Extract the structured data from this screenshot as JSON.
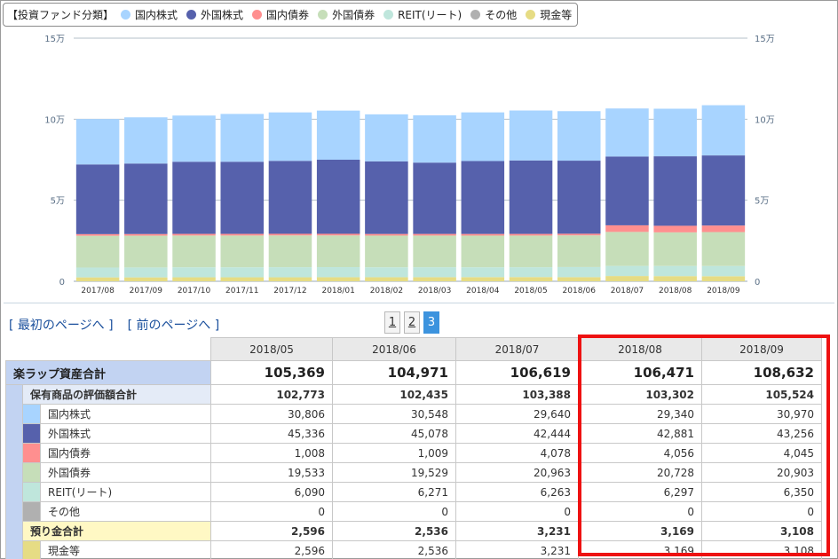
{
  "legend": {
    "title": "【投資ファンド分類】",
    "items": [
      {
        "label": "国内株式",
        "color": "#a8d4ff",
        "icon": "circle-icon"
      },
      {
        "label": "外国株式",
        "color": "#5661ac",
        "icon": "circle-icon"
      },
      {
        "label": "国内債券",
        "color": "#ff8f8f",
        "icon": "circle-icon"
      },
      {
        "label": "外国債券",
        "color": "#c6deb9",
        "icon": "circle-icon"
      },
      {
        "label": "REIT(リート)",
        "color": "#bfe6dc",
        "icon": "circle-icon"
      },
      {
        "label": "その他",
        "color": "#b0b0b0",
        "icon": "circle-icon"
      },
      {
        "label": "現金等",
        "color": "#e6dc84",
        "icon": "circle-icon"
      }
    ]
  },
  "chart_data": {
    "type": "bar",
    "stacked": true,
    "categories": [
      "2017/08",
      "2017/09",
      "2017/10",
      "2017/11",
      "2017/12",
      "2018/01",
      "2018/02",
      "2018/03",
      "2018/04",
      "2018/05",
      "2018/06",
      "2018/07",
      "2018/08",
      "2018/09"
    ],
    "y_ticks": [
      {
        "value": 0,
        "label": "0"
      },
      {
        "value": 50000,
        "label": "5万"
      },
      {
        "value": 100000,
        "label": "10万"
      },
      {
        "value": 150000,
        "label": "15万"
      }
    ],
    "ylim": [
      0,
      150000
    ],
    "grid": true,
    "series": [
      {
        "name": "現金等",
        "color": "#e6dc84",
        "values": [
          2400,
          2400,
          2450,
          2450,
          2450,
          2500,
          2500,
          2520,
          2550,
          2596,
          2536,
          3231,
          3169,
          3108
        ]
      },
      {
        "name": "その他",
        "color": "#b0b0b0",
        "values": [
          0,
          0,
          0,
          0,
          0,
          0,
          0,
          0,
          0,
          0,
          0,
          0,
          0,
          0
        ]
      },
      {
        "name": "REIT(リート)",
        "color": "#bfe6dc",
        "values": [
          6100,
          6150,
          6200,
          6200,
          6250,
          6250,
          6150,
          6150,
          6100,
          6090,
          6271,
          6263,
          6297,
          6350
        ]
      },
      {
        "name": "外国債券",
        "color": "#c6deb9",
        "values": [
          19600,
          19600,
          19600,
          19600,
          19600,
          19550,
          19550,
          19550,
          19550,
          19533,
          19529,
          20963,
          20728,
          20903
        ]
      },
      {
        "name": "国内債券",
        "color": "#ff8f8f",
        "values": [
          1000,
          1000,
          1000,
          1000,
          1000,
          1000,
          1000,
          1000,
          1005,
          1008,
          1009,
          4078,
          4056,
          4045
        ]
      },
      {
        "name": "外国株式",
        "color": "#5661ac",
        "values": [
          43000,
          43500,
          44500,
          44500,
          45000,
          45700,
          44800,
          44000,
          45000,
          45336,
          45078,
          42444,
          42881,
          43256
        ]
      },
      {
        "name": "国内株式",
        "color": "#a8d4ff",
        "values": [
          28000,
          28500,
          28500,
          29500,
          29900,
          30300,
          29000,
          29200,
          30000,
          30806,
          30548,
          29640,
          29340,
          30970
        ]
      }
    ]
  },
  "nav": {
    "first_page": "最初のページへ",
    "prev_page": "前のページへ",
    "bracket_open": "[",
    "bracket_close": "]"
  },
  "pager": {
    "pages": [
      "1",
      "2",
      "3"
    ],
    "current": "3"
  },
  "table": {
    "months": [
      "2018/05",
      "2018/06",
      "2018/07",
      "2018/08",
      "2018/09"
    ],
    "total": {
      "label": "楽ラップ資産合計",
      "values": [
        "105,369",
        "104,971",
        "106,619",
        "106,471",
        "108,632"
      ]
    },
    "holdings": {
      "label": "保有商品の評価額合計",
      "values": [
        "102,773",
        "102,435",
        "103,388",
        "103,302",
        "105,524"
      ]
    },
    "holding_rows": [
      {
        "label": "国内株式",
        "color": "#a8d4ff",
        "values": [
          "30,806",
          "30,548",
          "29,640",
          "29,340",
          "30,970"
        ]
      },
      {
        "label": "外国株式",
        "color": "#5661ac",
        "values": [
          "45,336",
          "45,078",
          "42,444",
          "42,881",
          "43,256"
        ]
      },
      {
        "label": "国内債券",
        "color": "#ff8f8f",
        "values": [
          "1,008",
          "1,009",
          "4,078",
          "4,056",
          "4,045"
        ]
      },
      {
        "label": "外国債券",
        "color": "#c6deb9",
        "values": [
          "19,533",
          "19,529",
          "20,963",
          "20,728",
          "20,903"
        ]
      },
      {
        "label": "REIT(リート)",
        "color": "#bfe6dc",
        "values": [
          "6,090",
          "6,271",
          "6,263",
          "6,297",
          "6,350"
        ]
      },
      {
        "label": "その他",
        "color": "#b0b0b0",
        "values": [
          "0",
          "0",
          "0",
          "0",
          "0"
        ]
      }
    ],
    "deposit": {
      "label": "預り金合計",
      "values": [
        "2,596",
        "2,536",
        "3,231",
        "3,169",
        "3,108"
      ]
    },
    "deposit_rows": [
      {
        "label": "現金等",
        "color": "#e6dc84",
        "values": [
          "2,596",
          "2,536",
          "3,231",
          "3,169",
          "3,108"
        ]
      }
    ]
  },
  "highlight_color": "#ee1111"
}
